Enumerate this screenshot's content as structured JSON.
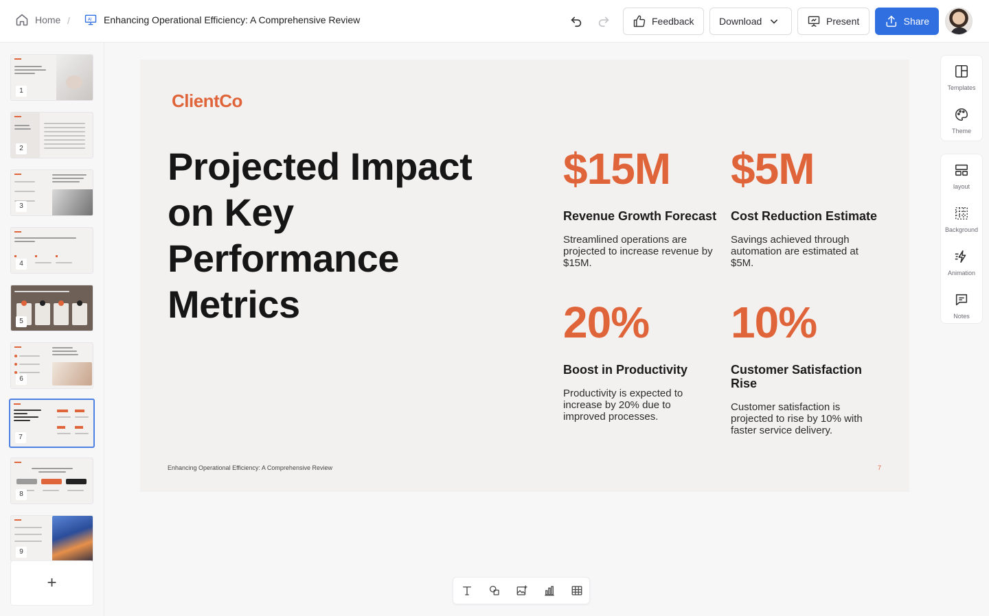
{
  "header": {
    "home_label": "Home",
    "doc_title": "Enhancing Operational Efficiency: A Comprehensive Review",
    "buttons": {
      "feedback": "Feedback",
      "download": "Download",
      "present": "Present",
      "share": "Share"
    }
  },
  "thumbnails": [
    {
      "number": "1"
    },
    {
      "number": "2"
    },
    {
      "number": "3"
    },
    {
      "number": "4"
    },
    {
      "number": "5"
    },
    {
      "number": "6"
    },
    {
      "number": "7",
      "active": true
    },
    {
      "number": "8"
    },
    {
      "number": "9"
    }
  ],
  "add_slide_label": "+",
  "slide": {
    "logo": "ClientCo",
    "title_lines": [
      "Projected Impact",
      "on Key",
      "Performance",
      "Metrics"
    ],
    "metrics": [
      {
        "value": "$15M",
        "label": "Revenue Growth Forecast",
        "description": "Streamlined operations are projected to increase revenue by $15M."
      },
      {
        "value": "$5M",
        "label": "Cost Reduction Estimate",
        "description": "Savings achieved through automation are estimated at $5M."
      },
      {
        "value": "20%",
        "label": "Boost in Productivity",
        "description": "Productivity is expected to increase by 20% due to improved processes."
      },
      {
        "value": "10%",
        "label": "Customer Satisfaction Rise",
        "description": "Customer satisfaction is projected to rise by 10% with faster service delivery."
      }
    ],
    "footer": "Enhancing Operational Efficiency: A Comprehensive Review",
    "page_number": "7"
  },
  "right_tools": {
    "templates": "Templates",
    "theme": "Theme",
    "layout": "layout",
    "background": "Background",
    "animation": "Animation",
    "notes": "Notes"
  },
  "colors": {
    "accent": "#e0643a",
    "primary_button": "#2f6fe0",
    "slide_background": "#f3f1f0"
  }
}
